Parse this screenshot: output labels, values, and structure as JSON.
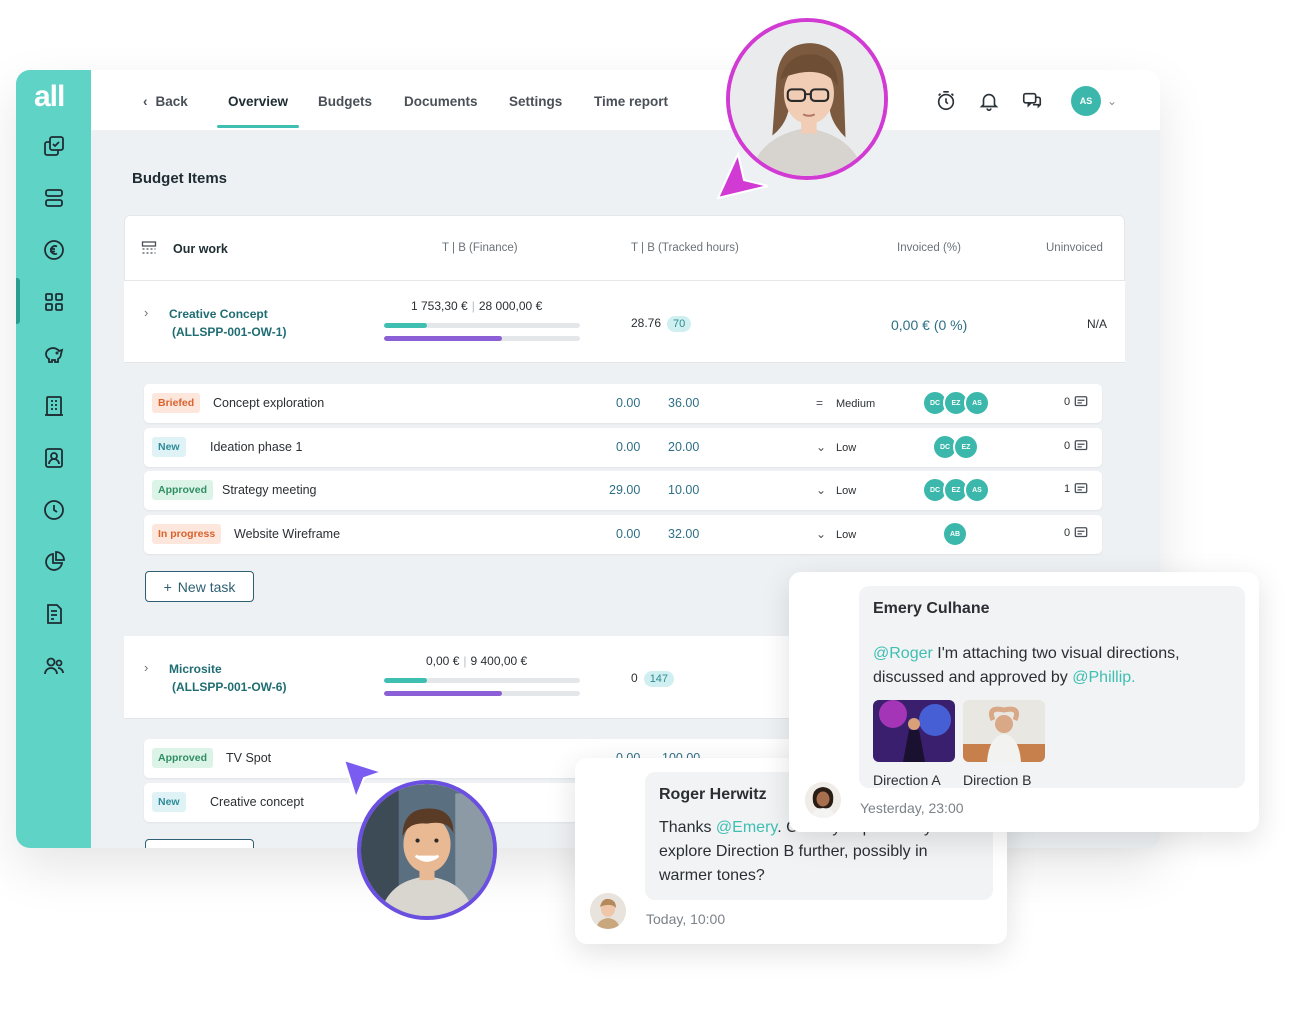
{
  "app": {
    "logo": "all",
    "nav": {
      "back": "Back",
      "tabs": [
        "Overview",
        "Budgets",
        "Documents",
        "Settings",
        "Time report"
      ],
      "user_initials": "AS"
    },
    "section_title": "Budget Items",
    "table_head": {
      "name": "Our work",
      "finance": "T | B (Finance)",
      "tracked": "T | B (Tracked hours)",
      "invoiced": "Invoiced (%)",
      "uninvoiced": "Uninvoiced"
    },
    "budget_items": [
      {
        "name": "Creative Concept",
        "code": "(ALLSPP-001-OW-1)",
        "tracked_finance": "1 753,30 €",
        "budget_finance": "28 000,00 €",
        "finance_progress": 0.22,
        "hours_progress": 0.6,
        "tracked_hours": "28.76",
        "budget_hours": "70",
        "invoiced": "0,00 € (0 %)",
        "uninvoiced": "N/A"
      },
      {
        "name": "Microsite",
        "code": "(ALLSPP-001-OW-6)",
        "tracked_finance": "0,00 €",
        "budget_finance": "9 400,00 €",
        "finance_progress": 0.22,
        "hours_progress": 0.6,
        "tracked_hours": "0",
        "budget_hours": "147"
      }
    ],
    "tasks": [
      {
        "status": "Briefed",
        "name": "Concept exploration",
        "t": "0.00",
        "b": "36.00",
        "priority": "Medium",
        "assignees": [
          "DC",
          "EZ",
          "AS"
        ],
        "comments": "0"
      },
      {
        "status": "New",
        "name": "Ideation phase 1",
        "t": "0.00",
        "b": "20.00",
        "priority": "Low",
        "assignees": [
          "DC",
          "EZ"
        ],
        "comments": "0"
      },
      {
        "status": "Approved",
        "name": "Strategy meeting",
        "t": "29.00",
        "b": "10.00",
        "priority": "Low",
        "assignees": [
          "DC",
          "EZ",
          "AS"
        ],
        "comments": "1"
      },
      {
        "status": "In progress",
        "name": "Website Wireframe",
        "t": "0.00",
        "b": "32.00",
        "priority": "Low",
        "assignees": [
          "AB"
        ],
        "comments": "0"
      }
    ],
    "new_task_label": "New task",
    "tasks2": [
      {
        "status": "Approved",
        "name": "TV Spot",
        "t": "0.00",
        "b": "100.00"
      },
      {
        "status": "New",
        "name": "Creative concept"
      }
    ]
  },
  "chat": {
    "emery": {
      "name": "Emery Culhane",
      "mention1": "@Roger",
      "text1": " I'm attaching two visual directions,",
      "text2": "discussed and approved by ",
      "mention2": "@Phillip.",
      "attachments": [
        "Direction A",
        "Direction B"
      ],
      "time": "Yesterday, 23:00"
    },
    "roger": {
      "name": "Roger Herwitz",
      "text_prefix": "Thanks ",
      "mention": "@Emery",
      "text_rest": ". Could you please try",
      "line2": "explore Direction B further, possibly in",
      "line3": "warmer tones?",
      "time": "Today, 10:00"
    }
  },
  "colors": {
    "sidebar": "#5fd3c6",
    "accent": "#3fbfb1",
    "finance_bar": "#3fbfb1",
    "hours_bar": "#8b5fd6",
    "woman_ring": "#d23bd3",
    "man_ring": "#6b4fe0"
  },
  "icons": [
    "copy-icon",
    "stack-icon",
    "euro-icon",
    "grid-icon",
    "piggybank-icon",
    "building-icon",
    "contact-icon",
    "clock-icon",
    "piechart-icon",
    "invoice-icon",
    "users-icon",
    "timer-icon",
    "bell-icon",
    "chat-icon",
    "comment-icon"
  ]
}
